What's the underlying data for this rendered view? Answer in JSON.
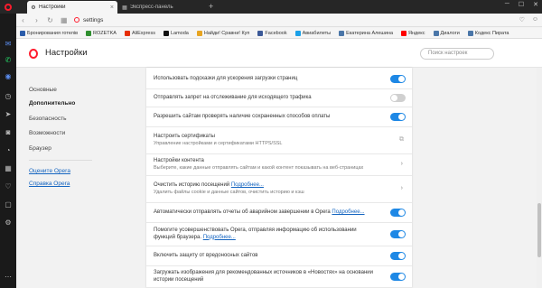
{
  "tabs": [
    {
      "label": "Настройки",
      "icon": "gear-icon",
      "active": true
    },
    {
      "label": "Экспресс-панель",
      "icon": "grid-icon",
      "active": false
    }
  ],
  "address": {
    "url": "settings"
  },
  "bookmarks": [
    {
      "label": "Бронирования готелів",
      "color": "#2a5caa"
    },
    {
      "label": "ROZETKA",
      "color": "#2f8f2f"
    },
    {
      "label": "AliExpress",
      "color": "#e62e04"
    },
    {
      "label": "Lamoda",
      "color": "#111111"
    },
    {
      "label": "Найди! Сравни! Куп",
      "color": "#e7a421"
    },
    {
      "label": "Facebook",
      "color": "#3b5998"
    },
    {
      "label": "Авиабилеты",
      "color": "#1aa0e8"
    },
    {
      "label": "Екатерина Алешина",
      "color": "#4a76a8"
    },
    {
      "label": "Яндекс",
      "color": "#ff0000"
    },
    {
      "label": "Диалоги",
      "color": "#4a76a8"
    },
    {
      "label": "Кодекс Пирата",
      "color": "#4a76a8"
    }
  ],
  "header": {
    "title": "Настройки",
    "search_placeholder": "Поиск настроек"
  },
  "nav": {
    "basic": "Основные",
    "advanced": "Дополнительно",
    "security": "Безопасность",
    "features": "Возможности",
    "browser": "Браузер",
    "rate": "Оцените Opera",
    "help": "Справка Opera"
  },
  "settings": [
    {
      "title": "Использовать подсказки для ускорения загрузки страниц",
      "control": "toggle",
      "on": true
    },
    {
      "title": "Отправлять запрет на отслеживание для исходящего трафика",
      "control": "toggle",
      "on": false
    },
    {
      "title": "Разрешить сайтам проверять наличие сохраненных способов оплаты",
      "control": "toggle",
      "on": true
    },
    {
      "title": "Настроить сертификаты",
      "subtitle": "Управление настройками и сертификатами HTTPS/SSL",
      "control": "external"
    },
    {
      "title": "Настройки контента",
      "subtitle": "Выберите, какие данные отправлять сайтам и какой контент показывать на веб-страницах",
      "control": "chevron"
    },
    {
      "title": "Очистить историю посещений",
      "link": "Подробнее...",
      "subtitle": "Удалить файлы cookie и данные сайтов, очистить историю и кэш",
      "control": "chevron"
    },
    {
      "title": "Автоматически отправлять отчеты об аварийном завершении в Opera",
      "link": "Подробнее...",
      "control": "toggle",
      "on": true
    },
    {
      "title": "Помогите усовершенствовать Opera, отправляя информацию об использовании функций браузера.",
      "link": "Подробнее...",
      "control": "toggle",
      "on": true
    },
    {
      "title": "Включить защиту от вредоносных сайтов",
      "control": "toggle",
      "on": true
    },
    {
      "title": "Загружать изображения для рекомендованных источников в «Новостях» на основании истории посещений",
      "control": "toggle",
      "on": true
    }
  ]
}
